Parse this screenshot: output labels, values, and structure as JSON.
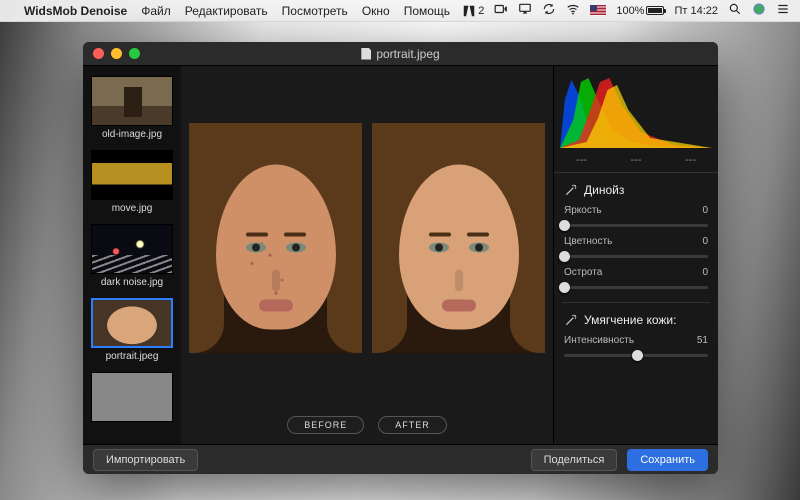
{
  "menubar": {
    "app_name": "WidsMob Denoise",
    "items": [
      "Файл",
      "Редактировать",
      "Посмотреть",
      "Окно",
      "Помощь"
    ],
    "right": {
      "adobe_count": "2",
      "battery_pct": "100%",
      "day_time": "Пт 14:22"
    }
  },
  "window": {
    "title": "portrait.jpeg"
  },
  "sidebar": {
    "thumbs": [
      {
        "label": "old-image.jpg",
        "cls": "th-old",
        "selected": false
      },
      {
        "label": "move.jpg",
        "cls": "th-move",
        "selected": false
      },
      {
        "label": "dark noise.jpg",
        "cls": "th-dark",
        "selected": false
      },
      {
        "label": "portrait.jpeg",
        "cls": "th-port",
        "selected": true
      },
      {
        "label": "",
        "cls": "th-5",
        "selected": false
      }
    ]
  },
  "compare": {
    "before": "BEFORE",
    "after": "AFTER"
  },
  "panel": {
    "readouts": [
      "---",
      "---",
      "---"
    ],
    "denoise": {
      "title": "Динойз",
      "sliders": [
        {
          "label": "Яркость",
          "value": "0",
          "pos": 0
        },
        {
          "label": "Цветность",
          "value": "0",
          "pos": 0
        },
        {
          "label": "Острота",
          "value": "0",
          "pos": 0
        }
      ]
    },
    "skin": {
      "title": "Умягчение кожи:",
      "sliders": [
        {
          "label": "Интенсивность",
          "value": "51",
          "pos": 51
        }
      ]
    }
  },
  "bottombar": {
    "import": "Импортировать",
    "share": "Поделиться",
    "save": "Сохранить"
  }
}
